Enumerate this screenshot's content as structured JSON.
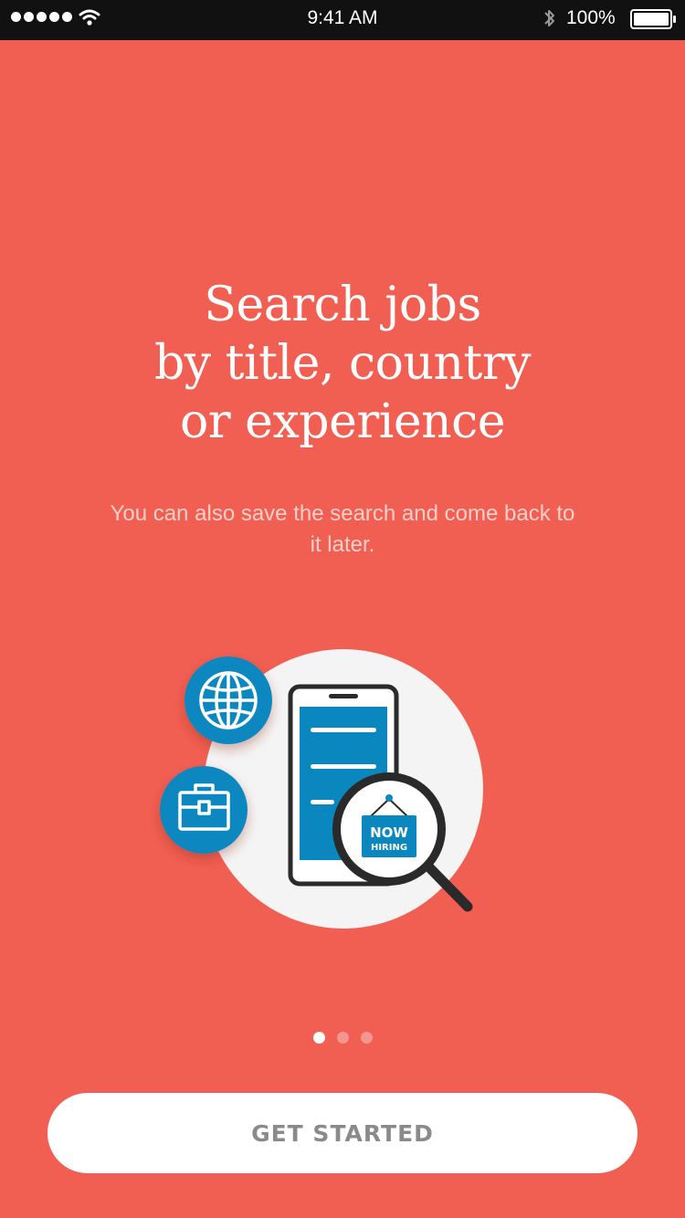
{
  "status_bar": {
    "time": "9:41 AM",
    "battery": "100%",
    "icons": [
      "signal-dots-icon",
      "wifi-icon",
      "bluetooth-icon",
      "battery-icon"
    ]
  },
  "onboarding": {
    "headline": [
      "Search jobs",
      "by title, country",
      "or experience"
    ],
    "subtitle": "You can also save the search and come back to it later.",
    "illustration": {
      "sign_line1": "NOW",
      "sign_line2": "HIRING",
      "icons": [
        "globe-icon",
        "briefcase-icon",
        "phone-icon",
        "magnifier-icon"
      ]
    },
    "page_count": 3,
    "active_page": 1,
    "cta_label": "GET STARTED"
  },
  "colors": {
    "background": "#F15F52",
    "accent_blue": "#0A87BF",
    "button_text": "#8A8A8A"
  }
}
